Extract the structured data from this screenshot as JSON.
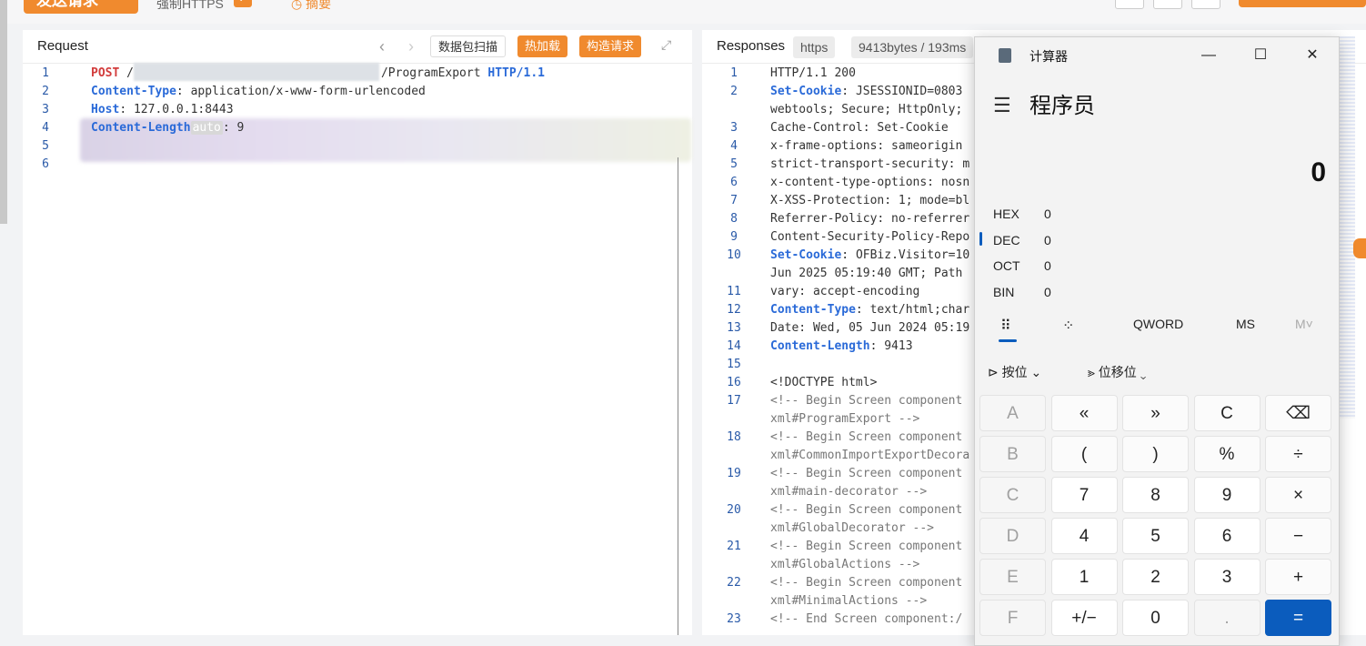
{
  "toolbar": {
    "send_label": "发送请求",
    "force_http_label": "强制HTTPS",
    "abstract_label": "摘要"
  },
  "request": {
    "title": "Request",
    "btn_scan": "数据包扫描",
    "btn_hotload": "热加载",
    "btn_build": "构造请求",
    "lines": [
      {
        "n": "1"
      },
      {
        "n": "2",
        "key": "Content-Type",
        "val": "application/x-www-form-urlencoded"
      },
      {
        "n": "3",
        "key": "Host",
        "val": "127.0.0.1:8443"
      },
      {
        "n": "4",
        "key": "Content-Length",
        "chip": "auto",
        "val": "9"
      },
      {
        "n": "5"
      },
      {
        "n": "6"
      }
    ],
    "line1_method": "POST",
    "line1_path": "/",
    "line1_path_tail": "/ProgramExport",
    "line1_proto": "HTTP/1.1"
  },
  "response": {
    "title": "Responses",
    "scheme": "https",
    "stats": "9413bytes / 193ms",
    "lines": [
      {
        "n": "1",
        "text": "HTTP/1.1 200"
      },
      {
        "n": "2",
        "key": "Set-Cookie",
        "text": "JSESSIONID=0803"
      },
      {
        "n": "",
        "text": "webtools; Secure; HttpOnly;"
      },
      {
        "n": "3",
        "text": "Cache-Control: Set-Cookie"
      },
      {
        "n": "4",
        "text": "x-frame-options: sameorigin"
      },
      {
        "n": "5",
        "text": "strict-transport-security: m"
      },
      {
        "n": "6",
        "text": "x-content-type-options: nosn"
      },
      {
        "n": "7",
        "text": "X-XSS-Protection: 1; mode=bl"
      },
      {
        "n": "8",
        "text": "Referrer-Policy: no-referrer"
      },
      {
        "n": "9",
        "text": "Content-Security-Policy-Repo"
      },
      {
        "n": "10",
        "key": "Set-Cookie",
        "text": "OFBiz.Visitor=10"
      },
      {
        "n": "",
        "text": "Jun 2025 05:19:40 GMT; Path"
      },
      {
        "n": "11",
        "text": "vary: accept-encoding"
      },
      {
        "n": "12",
        "key": "Content-Type",
        "text": "text/html;char"
      },
      {
        "n": "13",
        "text": "Date: Wed, 05 Jun 2024 05:19"
      },
      {
        "n": "14",
        "key": "Content-Length",
        "text": "9413"
      },
      {
        "n": "15",
        "text": ""
      },
      {
        "n": "16",
        "doctype": "<!DOCTYPE html>"
      },
      {
        "n": "17",
        "text": "<!-- Begin Screen component"
      },
      {
        "n": "",
        "text": "xml#ProgramExport -->"
      },
      {
        "n": "18",
        "text": "<!-- Begin Screen component"
      },
      {
        "n": "",
        "text": "xml#CommonImportExportDecora"
      },
      {
        "n": "19",
        "text": "<!-- Begin Screen component"
      },
      {
        "n": "",
        "text": "xml#main-decorator -->"
      },
      {
        "n": "20",
        "text": "<!-- Begin Screen component"
      },
      {
        "n": "",
        "text": "xml#GlobalDecorator -->"
      },
      {
        "n": "21",
        "text": "<!-- Begin Screen component"
      },
      {
        "n": "",
        "text": "xml#GlobalActions -->"
      },
      {
        "n": "22",
        "text": "<!-- Begin Screen component"
      },
      {
        "n": "",
        "text": "xml#MinimalActions -->"
      },
      {
        "n": "23",
        "text": "<!-- End Screen component:/"
      }
    ]
  },
  "calculator": {
    "title": "计算器",
    "mode": "程序员",
    "display": "0",
    "radix": [
      {
        "name": "HEX",
        "value": "0"
      },
      {
        "name": "DEC",
        "value": "0"
      },
      {
        "name": "OCT",
        "value": "0"
      },
      {
        "name": "BIN",
        "value": "0"
      }
    ],
    "word_size": "QWORD",
    "ms": "MS",
    "mplus": "M˅",
    "bitwise": "按位",
    "bitshift": "位移位",
    "keys": [
      [
        "A",
        "«",
        "»",
        "C",
        "⌫"
      ],
      [
        "B",
        "(",
        ")",
        "%",
        "÷"
      ],
      [
        "C",
        "7",
        "8",
        "9",
        "×"
      ],
      [
        "D",
        "4",
        "5",
        "6",
        "−"
      ],
      [
        "E",
        "1",
        "2",
        "3",
        "+"
      ],
      [
        "F",
        "+/−",
        "0",
        ".",
        "="
      ]
    ]
  }
}
